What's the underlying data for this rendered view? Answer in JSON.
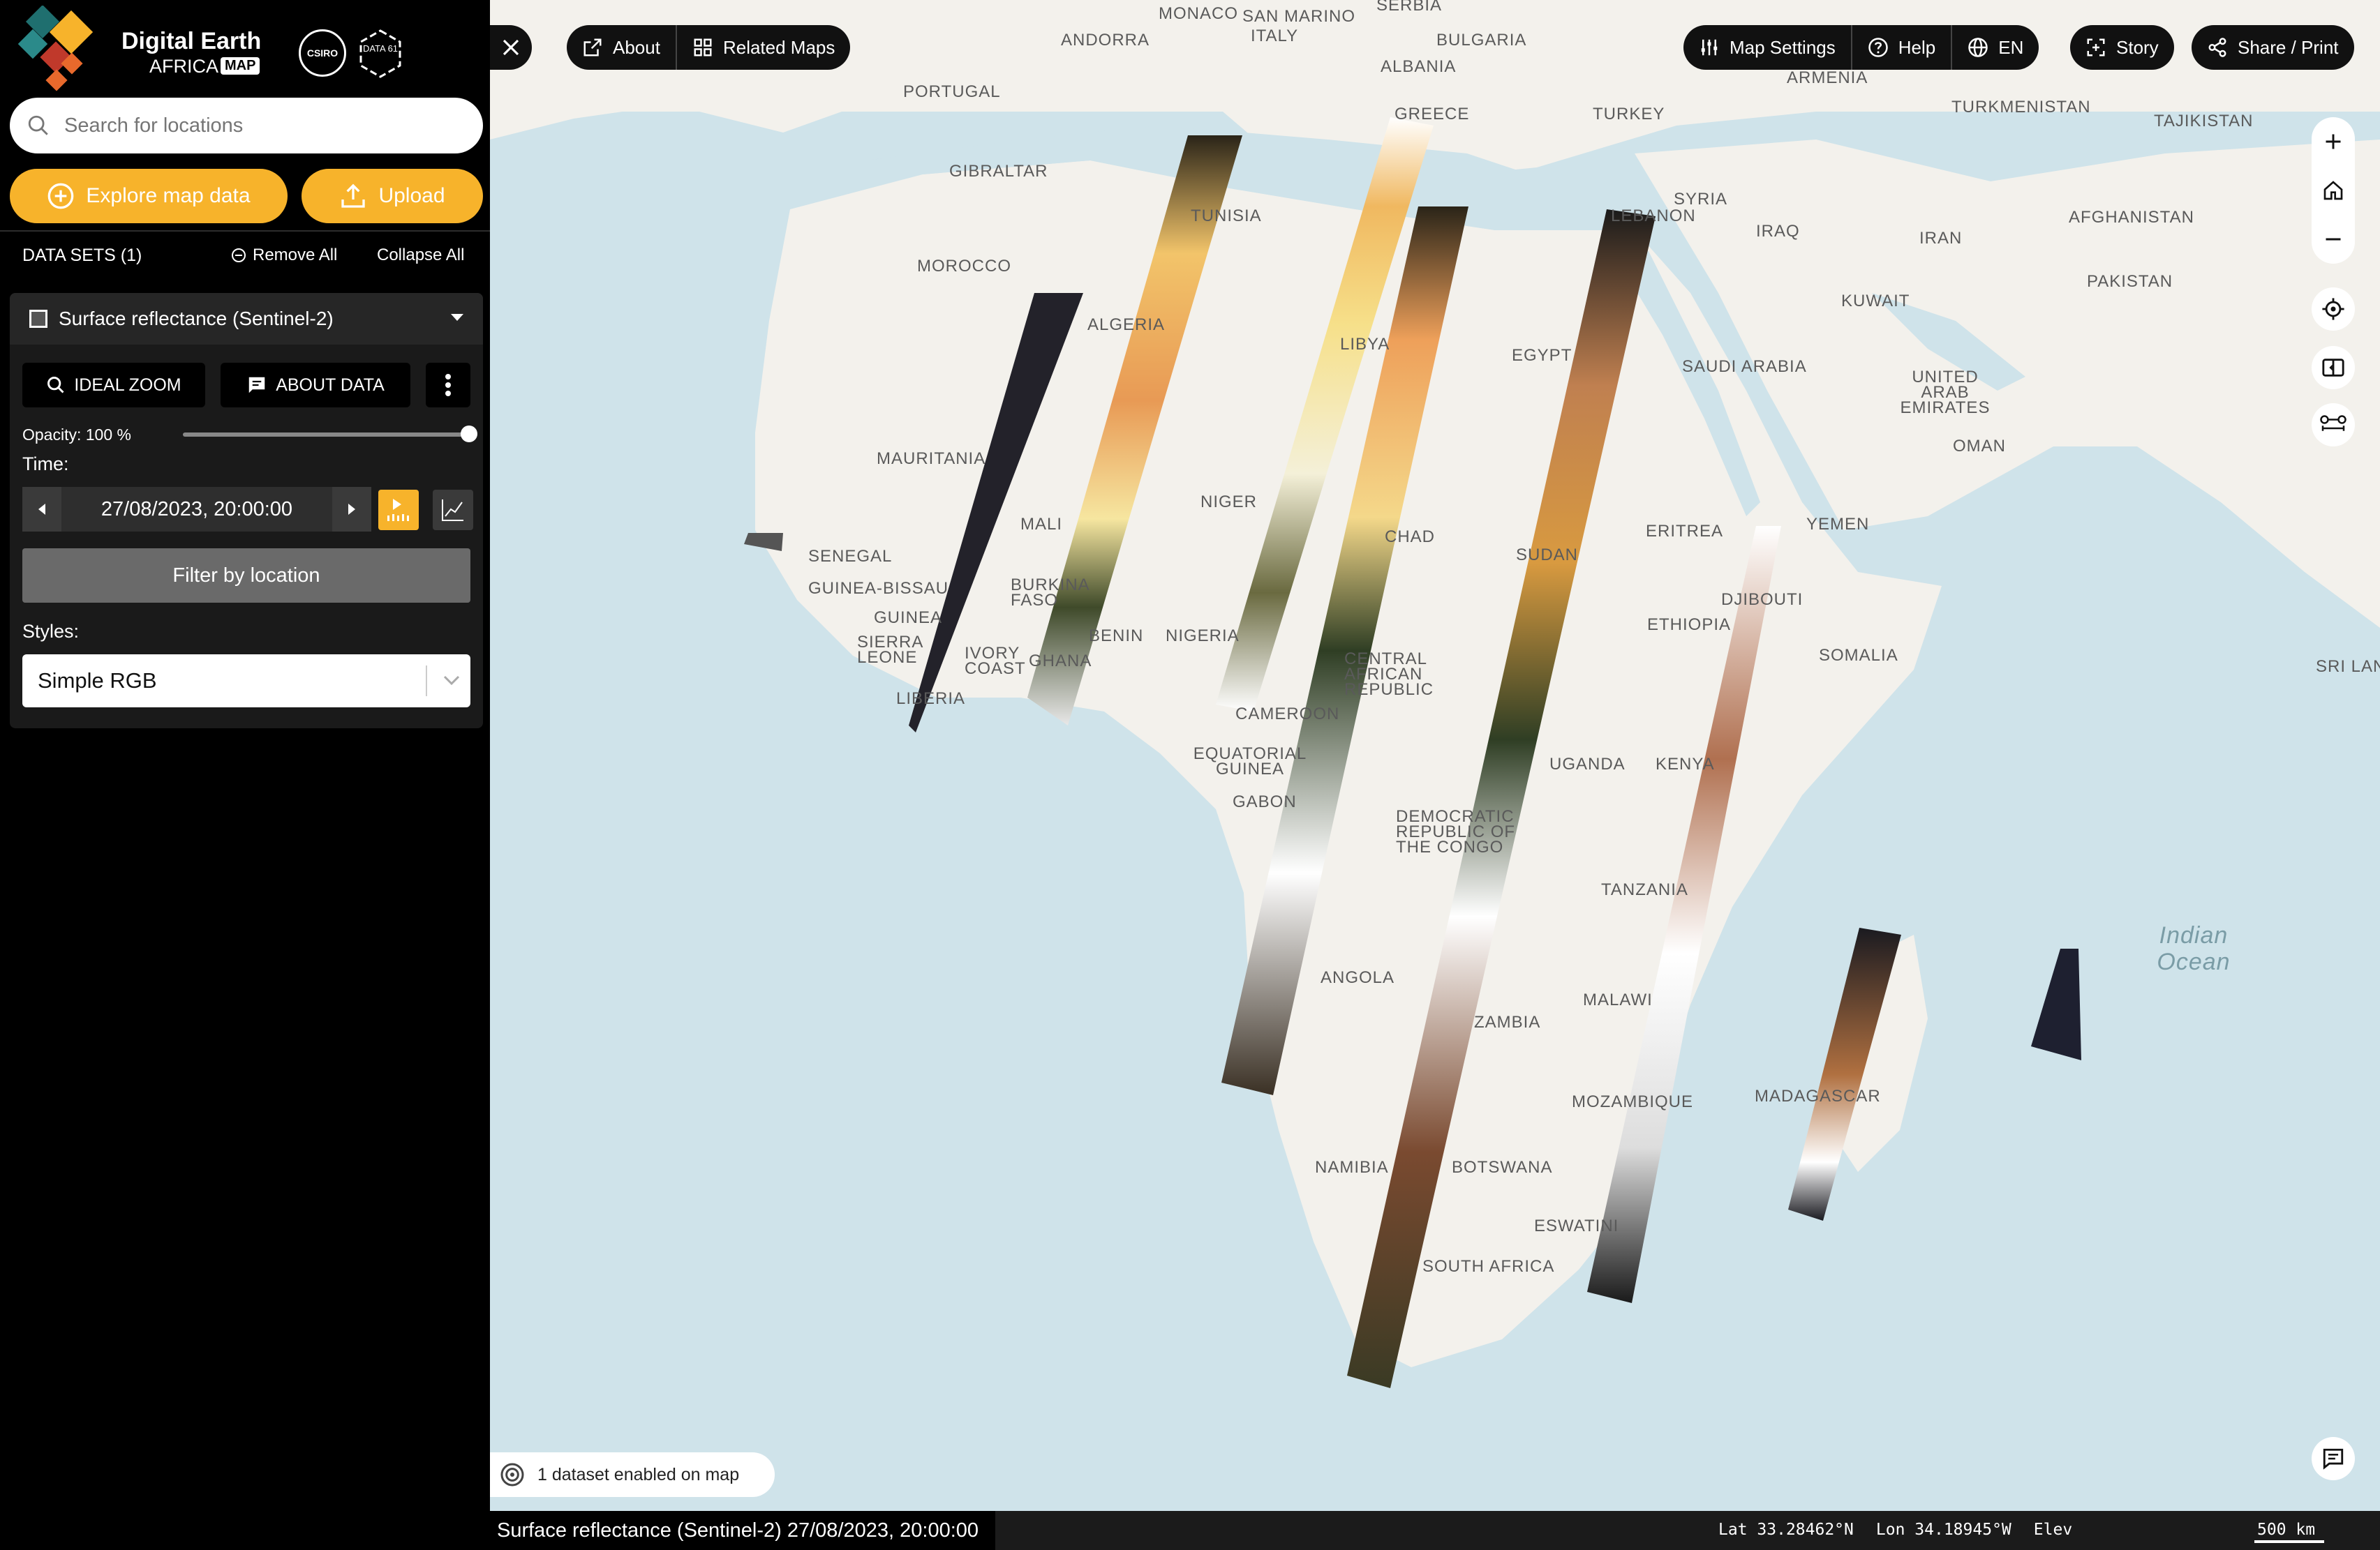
{
  "brand": {
    "title_line1": "Digital Earth",
    "title_line2": "AFRICA",
    "map_chip": "MAP",
    "partner1": "CSIRO",
    "partner2": "DATA 61"
  },
  "search": {
    "placeholder": "Search for locations"
  },
  "actions": {
    "explore_label": "Explore map data",
    "upload_label": "Upload"
  },
  "datasets": {
    "header": "DATA SETS (1)",
    "remove_all": "Remove All",
    "collapse_all": "Collapse All",
    "items": [
      {
        "name": "Surface reflectance (Sentinel-2)",
        "ideal_zoom_label": "IDEAL ZOOM",
        "about_data_label": "ABOUT DATA",
        "opacity_label": "Opacity: 100 %",
        "opacity_value": 1.0,
        "time_label": "Time:",
        "time_value": "27/08/2023, 20:00:00",
        "filter_label": "Filter by location",
        "styles_label": "Styles:",
        "style_value": "Simple RGB"
      }
    ]
  },
  "top_nav": {
    "about": "About",
    "related_maps": "Related Maps",
    "map_settings": "Map Settings",
    "help": "Help",
    "language": "EN",
    "story": "Story",
    "share_print": "Share / Print"
  },
  "map_labels": [
    "MONACO",
    "SAN MARINO",
    "ITALY",
    "SERBIA",
    "ANDORRA",
    "BULGARIA",
    "ALBANIA",
    "PORTUGAL",
    "GREECE",
    "TURKEY",
    "ARMENIA",
    "TURKMENISTAN",
    "TAJIKISTAN",
    "GIBRALTAR",
    "SYRIA",
    "LEBANON",
    "IRAQ",
    "IRAN",
    "AFGHANISTAN",
    "TUNISIA",
    "MOROCCO",
    "KUWAIT",
    "PAKISTAN",
    "ALGERIA",
    "LIBYA",
    "EGYPT",
    "SAUDI ARABIA",
    "UNITED ARAB EMIRATES",
    "OMAN",
    "MAURITANIA",
    "MALI",
    "NIGER",
    "CHAD",
    "SUDAN",
    "ERITREA",
    "YEMEN",
    "SENEGAL",
    "GUINEA-BISSAU",
    "GUINEA",
    "BURKINA FASO",
    "SIERRA LEONE",
    "IVORY COAST",
    "GHANA",
    "BENIN",
    "NIGERIA",
    "ETHIOPIA",
    "DJIBOUTI",
    "SOMALIA",
    "SRI LANKA",
    "LIBERIA",
    "CAMEROON",
    "CENTRAL AFRICAN REPUBLIC",
    "EQUATORIAL GUINEA",
    "GABON",
    "UGANDA",
    "KENYA",
    "DEMOCRATIC REPUBLIC OF THE CONGO",
    "TANZANIA",
    "Indian Ocean",
    "ANGOLA",
    "MALAWI",
    "ZAMBIA",
    "MOZAMBIQUE",
    "MADAGASCAR",
    "NAMIBIA",
    "BOTSWANA",
    "ESWATINI",
    "SOUTH AFRICA"
  ],
  "status": {
    "datasets_enabled": "1 dataset enabled on map",
    "layer_info": "Surface reflectance (Sentinel-2) 27/08/2023, 20:00:00",
    "lat_label": "Lat",
    "lat_value": "33.28462°N",
    "lon_label": "Lon",
    "lon_value": "34.18945°W",
    "elev_label": "Elev",
    "scale_label": "500 km"
  },
  "colors": {
    "accent": "#f7b32b",
    "sidebar_bg": "#000000",
    "ocean": "#cfe3ea",
    "land": "#f3f1ec"
  }
}
